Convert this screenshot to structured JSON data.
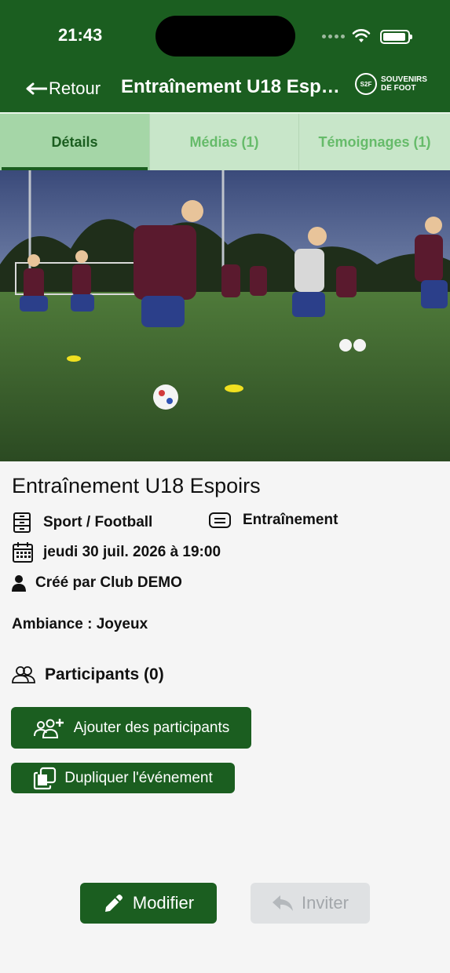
{
  "status_bar": {
    "time": "21:43"
  },
  "header": {
    "back_label": "Retour",
    "title": "Entraînement U18 Espoirs",
    "logo_badge": "S2F",
    "logo_text_1": "SOUVENIRS",
    "logo_text_2": "DE FOOT"
  },
  "tabs": [
    {
      "label": "Détails",
      "active": true
    },
    {
      "label": "Médias (1)",
      "active": false
    },
    {
      "label": "Témoignages (1)",
      "active": false
    }
  ],
  "event": {
    "title": "Entraînement U18 Espoirs",
    "sport": "Sport / Football",
    "type": "Entraînement",
    "date": "jeudi 30 juil. 2026 à 19:00",
    "creator": "Créé par Club DEMO",
    "mood": "Ambiance : Joyeux",
    "participants": "Participants (0)"
  },
  "actions": {
    "add_participants": "Ajouter des participants",
    "duplicate": "Dupliquer l'événement",
    "edit": "Modifier",
    "invite": "Inviter"
  },
  "colors": {
    "brand_green": "#1b5e20",
    "tab_bg": "#c8e6c9",
    "tab_active_bg": "#a5d6a7",
    "disabled_bg": "#dfe1e3"
  }
}
